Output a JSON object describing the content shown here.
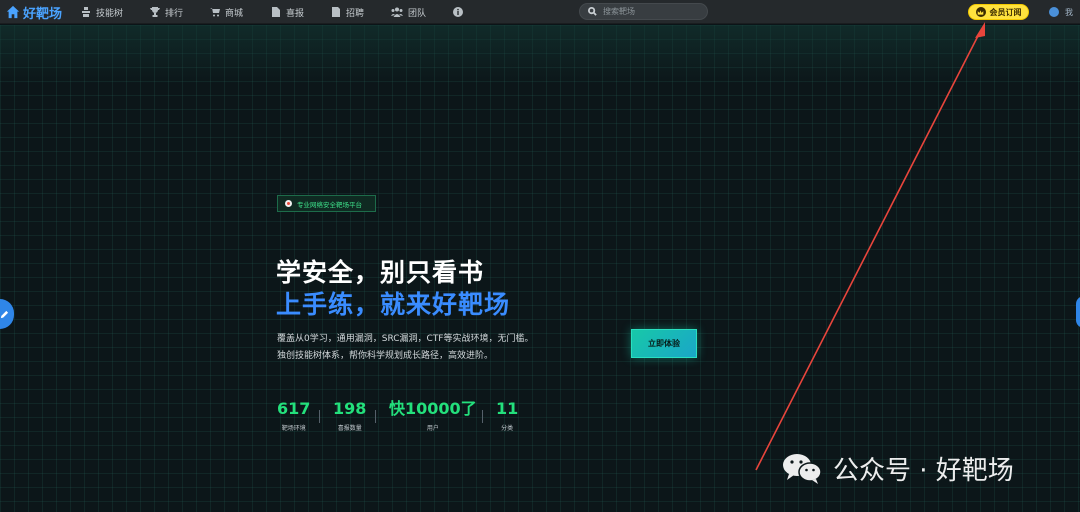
{
  "nav": {
    "logo": "好靶场",
    "items": [
      {
        "label": "技能树",
        "icon": "skill-tree-icon"
      },
      {
        "label": "排行",
        "icon": "trophy-icon"
      },
      {
        "label": "商城",
        "icon": "cart-icon"
      },
      {
        "label": "喜报",
        "icon": "document-icon"
      },
      {
        "label": "招聘",
        "icon": "briefcase-icon"
      },
      {
        "label": "团队",
        "icon": "team-icon"
      },
      {
        "label": "",
        "icon": "info-icon"
      }
    ],
    "search_placeholder": "搜索靶场",
    "vip_label": "会员订阅",
    "user_label": "我"
  },
  "hero": {
    "badge": "专业网络安全靶场平台",
    "title_line1": "学安全，别只看书",
    "title_line2": "上手练，就来好靶场",
    "desc_line1": "覆盖从0学习，通用漏洞，SRC漏洞，CTF等实战环境，无门槛。",
    "desc_line2": "独创技能树体系，帮你科学规划成长路径，高效进阶。",
    "cta": "立即体验",
    "stats": [
      {
        "value": "617",
        "label": "靶场环境"
      },
      {
        "value": "198",
        "label": "喜报数量"
      },
      {
        "value": "快10000了",
        "label": "用户"
      },
      {
        "value": "11",
        "label": "分类"
      }
    ]
  },
  "watermark": "公众号 · 好靶场",
  "colors": {
    "accent_blue": "#3a8cff",
    "accent_green": "#23e07c",
    "vip_yellow": "#ffe23e",
    "annotation_red": "#e8453c"
  }
}
